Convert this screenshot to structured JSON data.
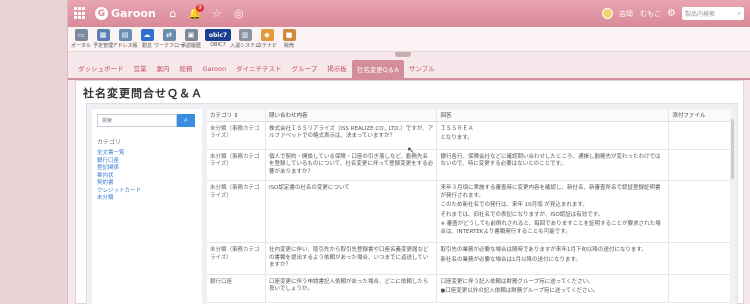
{
  "topbar": {
    "app_name": "Garoon",
    "notification_badge": "9",
    "user_name": "吉岡　むもこ",
    "search_placeholder": "製品内検索",
    "icons": [
      "grid-icon",
      "home-icon",
      "bell-icon",
      "star-icon",
      "gear-icon"
    ]
  },
  "apps": [
    {
      "label": "ポータル",
      "color": "#7a8a9a",
      "glyph": "▭"
    },
    {
      "label": "予定管理",
      "color": "#5a7fb0",
      "glyph": "▦"
    },
    {
      "label": "アドレス帳",
      "color": "#6a8fb5",
      "glyph": "▤"
    },
    {
      "label": "勤怠",
      "color": "#2f6fd0",
      "glyph": "☁"
    },
    {
      "label": "ワークフロー",
      "color": "#6c8cab",
      "glyph": "⇄"
    },
    {
      "label": "承認履歴",
      "color": "#7a8898",
      "glyph": "▣"
    },
    {
      "label": "OBIC7",
      "color": "#1b3f8f",
      "glyph": "obic7"
    },
    {
      "label": "入退システム",
      "color": "#8a93a3",
      "glyph": "▥"
    },
    {
      "label": "カテナビ",
      "color": "#e39a3a",
      "glyph": "◆"
    },
    {
      "label": "販売",
      "color": "#d08a40",
      "glyph": "■"
    }
  ],
  "nav": {
    "items": [
      "ダッシュボード",
      "営業",
      "案内",
      "総務",
      "Garoon",
      "ダイニチテスト",
      "グループ",
      "掲示板",
      "社名変更Q＆A",
      "サンプル"
    ],
    "active_index": 8
  },
  "page": {
    "title": "社名変更問合せＱ＆Ａ"
  },
  "left_panel": {
    "search_placeholder": "検索",
    "search_button_icon": "search-icon",
    "category_heading": "カテゴリ",
    "categories": [
      "全文書一覧",
      "銀行口座",
      "登記関係",
      "案内状",
      "契約書",
      "クレジットカード",
      "未分類"
    ]
  },
  "table": {
    "headers": [
      "カテゴリ ⇕",
      "問い合わせ内容",
      "回答",
      "添付ファイル"
    ],
    "rows": [
      {
        "category": "未分類（事務カテゴライズ）",
        "question": "株式会社ＩＳＳリアライズ（ISS REALIZE CO., LTD.）ですが、アルファベットでの略式表示は、決まっていますか？",
        "answer": [
          "ＩＳＳＲＥＡ",
          "となります。"
        ],
        "attachment": ""
      },
      {
        "category": "未分類（事務カテゴライズ）",
        "question": "個人で契約・開設している保険・口座の引き落しなど、勤務先名を登録しているものについて、社名変更に伴って登録変更をする必要がありますか？",
        "answer": [
          "銀行各行、保険会社などに確認問い合わせしたところ、通帳し勤務先が変わったわけではないので、特に変更する必要はないとのことです。"
        ],
        "attachment": ""
      },
      {
        "category": "未分類（事務カテゴライズ）",
        "question": "ISO認定書の社名の変更について",
        "answer": [
          "来年３月頃に実施する審査時に変更内容を確認し、新社名、新審査所名で認証登録証明書が発行されます。",
          "このため新社名での発行は、来年 10月頃 が見込まれます。",
          "それまでは、旧社名での表記になりますが、ISO認証は有効です。",
          "※ 審査がどうしても前倒れされると、毎回でありますことを証明することが要求された場合は、INTERTEKより書類発行することも可能です。"
        ],
        "attachment": ""
      },
      {
        "category": "未分類（事務カテゴライズ）",
        "question": "社内変更に伴い、取引先から取引先登録書や口座名義変更届などの書類を提出するよう依頼があった場合、いつまでに返送していますか？",
        "answer": [
          "取引先の業務が必要な場合は随時でありますが来年1月下旬以降の送付になります。",
          "新社名の業務が必要な場合は1月以降の送付になります。"
        ],
        "attachment": ""
      },
      {
        "category": "銀行口座",
        "question": "口座変更に伴う申請書記入依頼があった場合、どこに依頼したら良いでしょうか。",
        "answer": [
          "口座変更に伴う記入依頼は財務グループ宛に送ってください。",
          "●口座変更以外の記入依頼は財務グループ宛に送ってください。"
        ],
        "attachment": ""
      }
    ]
  },
  "colors": {
    "topbar": "#d98a99",
    "nav_accent": "#c0506a",
    "link": "#3a7bd5",
    "search_button": "#3a8de0"
  }
}
